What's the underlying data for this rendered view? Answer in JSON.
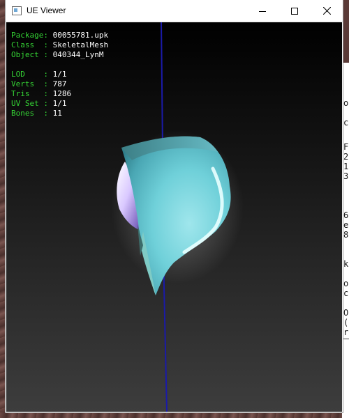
{
  "window": {
    "title": "UE Viewer"
  },
  "overlay": {
    "rows_top": [
      {
        "label": "Package: ",
        "value": "00055781.upk"
      },
      {
        "label": "Class  : ",
        "value": "SkeletalMesh"
      },
      {
        "label": "Object : ",
        "value": "040344_LynM"
      }
    ],
    "rows_bottom": [
      {
        "label": "LOD    : ",
        "value": "1/1"
      },
      {
        "label": "Verts  : ",
        "value": "787"
      },
      {
        "label": "Tris   : ",
        "value": "1286"
      },
      {
        "label": "UV Set : ",
        "value": "1/1"
      },
      {
        "label": "Bones  : ",
        "value": "11"
      }
    ]
  },
  "console_chars": [
    "o",
    "c",
    "F",
    "2",
    "1",
    "3",
    "6",
    "e",
    "8",
    "k",
    "o",
    "c",
    "O",
    "(",
    "r"
  ],
  "colors": {
    "label": "#35d435",
    "value": "#ffffff",
    "axis": "#1a1aa8",
    "mesh": "#6fd3dc"
  },
  "icons": {
    "app": "app-window-icon",
    "minimize": "minimize-icon",
    "maximize": "maximize-icon",
    "close": "close-icon"
  }
}
